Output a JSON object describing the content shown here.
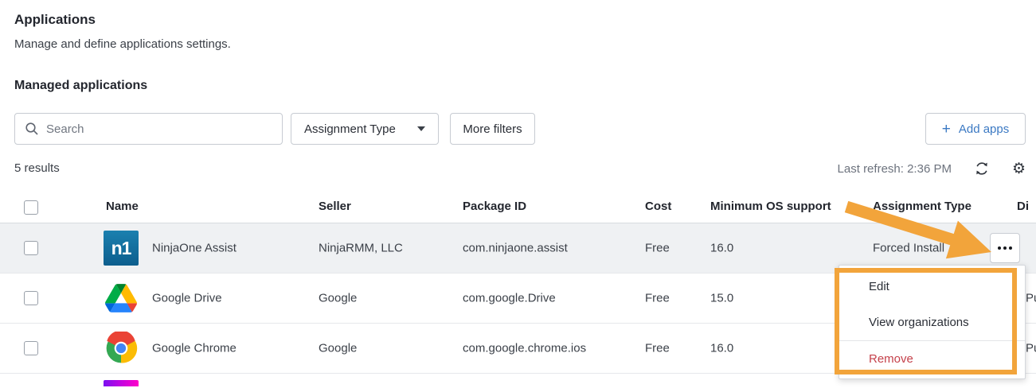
{
  "page": {
    "title": "Applications",
    "subtitle": "Manage and define applications settings.",
    "section_title": "Managed applications"
  },
  "toolbar": {
    "search_placeholder": "Search",
    "assignment_type_filter_label": "Assignment Type",
    "more_filters_label": "More filters",
    "add_apps_label": "Add apps",
    "add_apps_plus": "+"
  },
  "status": {
    "results_count": "5 results",
    "last_refresh": "Last refresh: 2:36 PM"
  },
  "table": {
    "columns": [
      "Name",
      "Seller",
      "Package ID",
      "Cost",
      "Minimum OS support",
      "Assignment Type",
      "Di"
    ],
    "rows": [
      {
        "name": "NinjaOne Assist",
        "seller": "NinjaRMM, LLC",
        "package_id": "com.ninjaone.assist",
        "cost": "Free",
        "min_os": "16.0",
        "assignment_type": "Forced Install",
        "icon": "ninjaone-n1-logo",
        "icon_text": "n1"
      },
      {
        "name": "Google Drive",
        "seller": "Google",
        "package_id": "com.google.Drive",
        "cost": "Free",
        "min_os": "15.0",
        "distribution_visible_fragment": "Pu",
        "icon": "google-drive-logo"
      },
      {
        "name": "Google Chrome",
        "seller": "Google",
        "package_id": "com.google.chrome.ios",
        "cost": "Free",
        "min_os": "16.0",
        "distribution_visible_fragment": "Pu",
        "icon": "google-chrome-logo"
      }
    ]
  },
  "context_menu": {
    "items": [
      {
        "label": "Edit"
      },
      {
        "label": "View organizations"
      },
      {
        "label": "Remove"
      }
    ]
  },
  "colors": {
    "accent_blue": "#3b79c3",
    "annotation_orange": "#f2a43b",
    "danger_red": "#c5414b",
    "selected_row_bg": "#eff1f3"
  }
}
